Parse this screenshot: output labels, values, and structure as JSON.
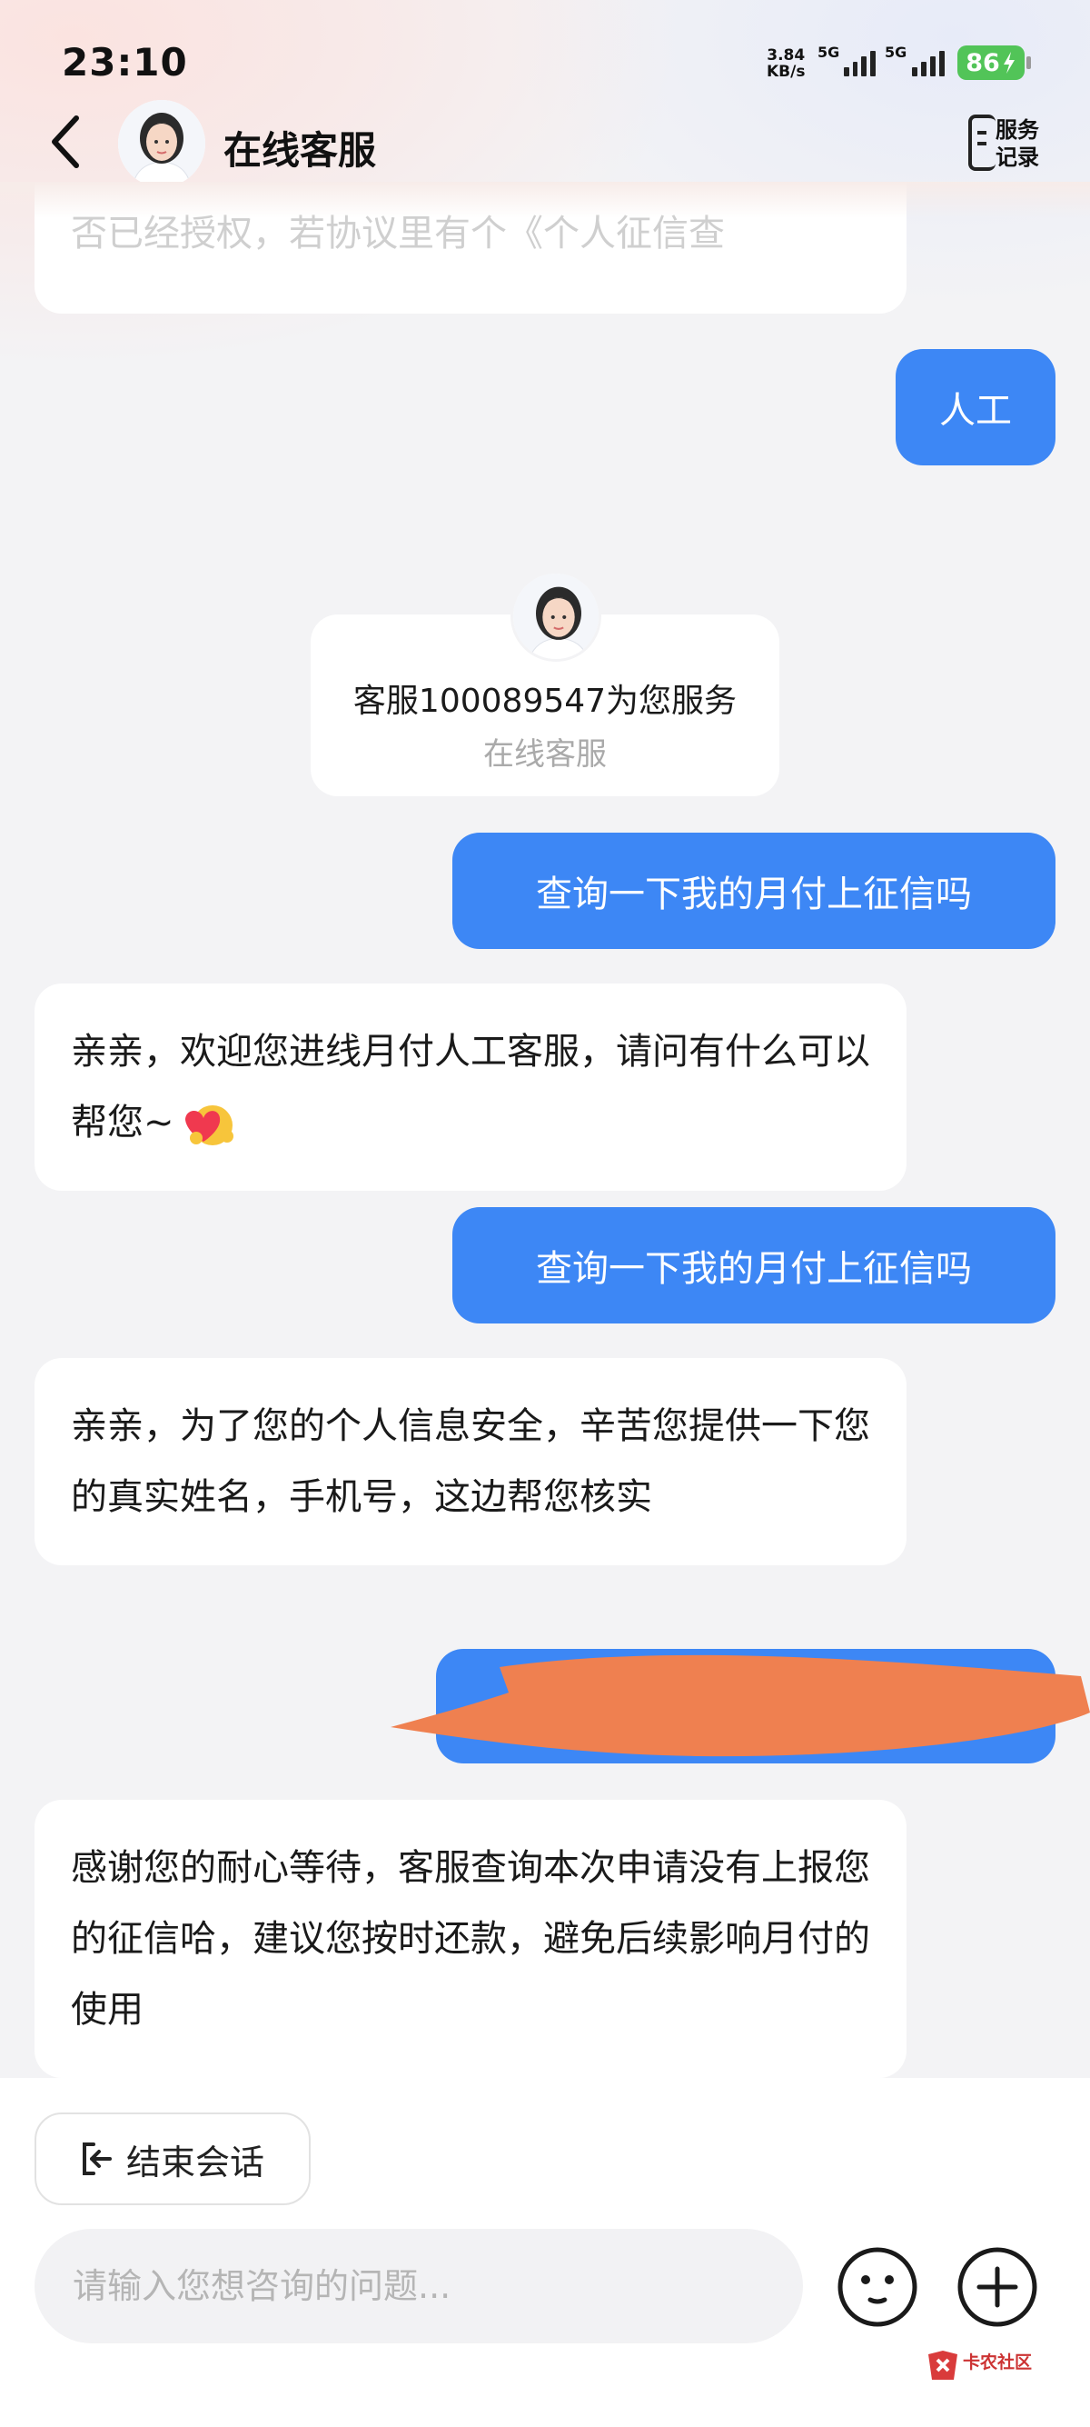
{
  "status_bar": {
    "time": "23:10",
    "net_speed_value": "3.84",
    "net_speed_unit": "KB/s",
    "signal_1_label": "5G",
    "signal_2_label": "5G",
    "battery": "86"
  },
  "header": {
    "title": "在线客服",
    "service_record_line1": "服务",
    "service_record_line2": "记录"
  },
  "chat": {
    "cut_top_text": "否已经授权，若协议里有个《个人征信查",
    "user_msg_1": "人工",
    "agent_card": {
      "line": "客服100089547为您服务",
      "sub": "在线客服"
    },
    "user_msg_2": "查询一下我的月付上征信吗",
    "agent_msg_1": "亲亲，欢迎您进线月付人工客服，请问有什么可以帮您~",
    "user_msg_3": "查询一下我的月付上征信吗",
    "agent_msg_2": "亲亲，为了您的个人信息安全，辛苦您提供一下您的真实姓名，手机号，这边帮您核实",
    "agent_msg_3": "感谢您的耐心等待，客服查询本次申请没有上报您的征信哈，建议您按时还款，避免后续影响月付的使用"
  },
  "bottom": {
    "end_session_label": "结束会话",
    "input_placeholder": "请输入您想咨询的问题...",
    "watermark": "卡农社区"
  },
  "colors": {
    "user_bubble": "#3d87f5",
    "battery": "#52c458",
    "redaction": "#ef8050"
  }
}
